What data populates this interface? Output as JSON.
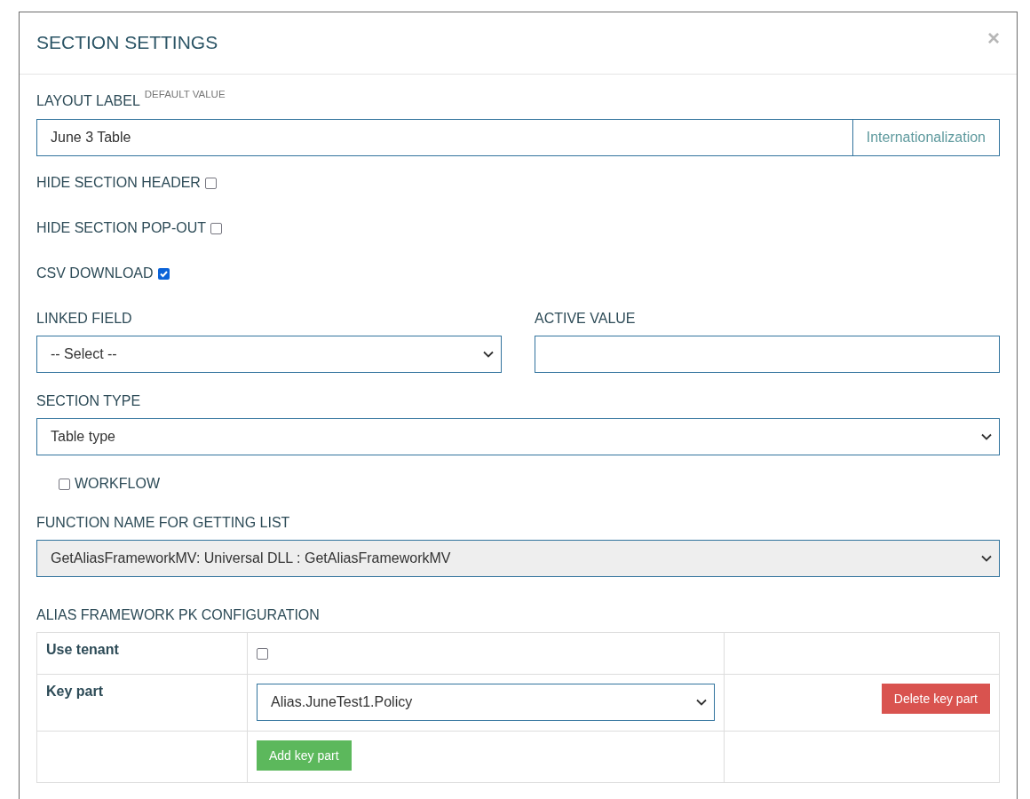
{
  "modal": {
    "title": "SECTION SETTINGS",
    "close": "×"
  },
  "layout_label": {
    "label": "LAYOUT LABEL",
    "note": "DEFAULT VALUE",
    "value": "June 3 Table",
    "button": "Internationalization"
  },
  "options": [
    {
      "label": "HIDE SECTION HEADER",
      "checked": false
    },
    {
      "label": "HIDE SECTION POP-OUT",
      "checked": false
    },
    {
      "label": "CSV DOWNLOAD",
      "checked": true
    }
  ],
  "linked_field": {
    "label": "LINKED FIELD",
    "value": "-- Select --"
  },
  "active_value": {
    "label": "ACTIVE VALUE"
  },
  "section_type": {
    "label": "SECTION TYPE",
    "value": "Table type"
  },
  "workflow": {
    "label": "WORKFLOW",
    "checked": false
  },
  "function_name": {
    "label": "FUNCTION NAME FOR GETTING LIST",
    "value": "GetAliasFrameworkMV: Universal DLL : GetAliasFrameworkMV",
    "disabled": true
  },
  "alias_config": {
    "title": "ALIAS FRAMEWORK PK CONFIGURATION",
    "use_tenant": {
      "label": "Use tenant",
      "checked": false
    },
    "key_parts": [
      {
        "label": "Key part",
        "value": "Alias.JuneTest1.Policy",
        "delete_button": "Delete key part"
      }
    ],
    "add_button": "Add key part"
  }
}
